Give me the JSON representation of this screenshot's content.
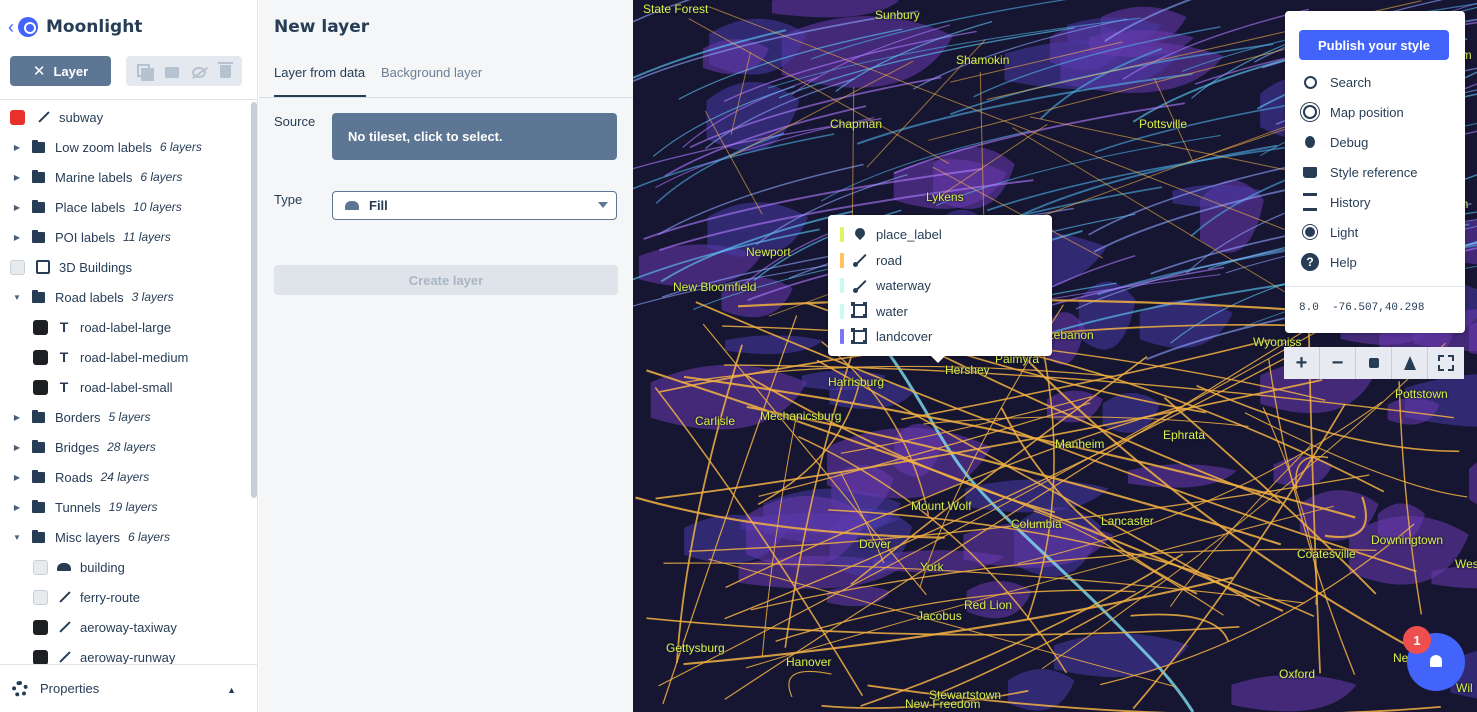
{
  "app": {
    "name": "Moonlight",
    "back_icon": "chevron-left-icon",
    "logo_icon": "mapbox-logo-icon"
  },
  "toolbar": {
    "layer_button": "Layer",
    "close_icon": "close-icon"
  },
  "layers": [
    {
      "kind": "layer",
      "name": "subway",
      "color": "#e8302c",
      "icon": "line"
    },
    {
      "kind": "group",
      "name": "Low zoom labels",
      "count": "6 layers",
      "expanded": false
    },
    {
      "kind": "group",
      "name": "Marine labels",
      "count": "6 layers",
      "expanded": false
    },
    {
      "kind": "group",
      "name": "Place labels",
      "count": "10 layers",
      "expanded": false
    },
    {
      "kind": "group",
      "name": "POI labels",
      "count": "11 layers",
      "expanded": false
    },
    {
      "kind": "layer",
      "name": "3D Buildings",
      "color": "#e8ebee",
      "icon": "cube"
    },
    {
      "kind": "group",
      "name": "Road labels",
      "count": "3 layers",
      "expanded": true
    },
    {
      "kind": "child",
      "name": "road-label-large",
      "color": "#1d1f22",
      "icon": "text"
    },
    {
      "kind": "child",
      "name": "road-label-medium",
      "color": "#1d1f22",
      "icon": "text"
    },
    {
      "kind": "child",
      "name": "road-label-small",
      "color": "#1d1f22",
      "icon": "text"
    },
    {
      "kind": "group",
      "name": "Borders",
      "count": "5 layers",
      "expanded": false
    },
    {
      "kind": "group",
      "name": "Bridges",
      "count": "28 layers",
      "expanded": false
    },
    {
      "kind": "group",
      "name": "Roads",
      "count": "24 layers",
      "expanded": false
    },
    {
      "kind": "group",
      "name": "Tunnels",
      "count": "19 layers",
      "expanded": false
    },
    {
      "kind": "group",
      "name": "Misc layers",
      "count": "6 layers",
      "expanded": true
    },
    {
      "kind": "child",
      "name": "building",
      "color": "#e8ebee",
      "icon": "fill"
    },
    {
      "kind": "child",
      "name": "ferry-route",
      "color": "#e8ebee",
      "icon": "line"
    },
    {
      "kind": "child",
      "name": "aeroway-taxiway",
      "color": "#1d1f22",
      "icon": "line"
    },
    {
      "kind": "child",
      "name": "aeroway-runway",
      "color": "#1d1f22",
      "icon": "line"
    }
  ],
  "properties": {
    "label": "Properties"
  },
  "new_layer": {
    "title": "New layer",
    "tabs": [
      "Layer from data",
      "Background layer"
    ],
    "source_label": "Source",
    "source_value": "No tileset, click to select.",
    "type_label": "Type",
    "type_value": "Fill",
    "create_button": "Create layer"
  },
  "map": {
    "places": [
      {
        "name": "State Forest"
      },
      {
        "name": "Sunbury"
      },
      {
        "name": "Shamokin"
      },
      {
        "name": "Chapman"
      },
      {
        "name": "Pottsville"
      },
      {
        "name": "Lykens"
      },
      {
        "name": "Newport"
      },
      {
        "name": "New Bloomfield"
      },
      {
        "name": "Lebanon"
      },
      {
        "name": "Harrisburg"
      },
      {
        "name": "Hershey"
      },
      {
        "name": "Mechanicsburg"
      },
      {
        "name": "Carlisle"
      },
      {
        "name": "Manheim"
      },
      {
        "name": "Ephrata"
      },
      {
        "name": "Mount Wolf"
      },
      {
        "name": "Columbia"
      },
      {
        "name": "Lancaster"
      },
      {
        "name": "Dover"
      },
      {
        "name": "York"
      },
      {
        "name": "Red Lion"
      },
      {
        "name": "Jacobus"
      },
      {
        "name": "Gettysburg"
      },
      {
        "name": "Hanover"
      },
      {
        "name": "Stewartstown"
      },
      {
        "name": "New Freedom"
      },
      {
        "name": "Oxford"
      },
      {
        "name": "Coatesville"
      },
      {
        "name": "Downingtown"
      },
      {
        "name": "West G"
      },
      {
        "name": "Pottstown"
      },
      {
        "name": "New Gar"
      },
      {
        "name": "Wyomiss"
      },
      {
        "name": "Ham"
      },
      {
        "name": "Tam"
      },
      {
        "name": "Wil"
      },
      {
        "name": "Palmyra"
      }
    ],
    "popup": [
      {
        "name": "place_label",
        "color": "#d9f75f",
        "icon": "pin"
      },
      {
        "name": "road",
        "color": "#ffc25c",
        "icon": "road"
      },
      {
        "name": "waterway",
        "color": "#c6faf3",
        "icon": "road"
      },
      {
        "name": "water",
        "color": "#c6faf3",
        "icon": "poly"
      },
      {
        "name": "landcover",
        "color": "#7b74f6",
        "icon": "poly"
      }
    ],
    "menu": {
      "publish": "Publish your style",
      "items": [
        {
          "label": "Search",
          "icon": "search-icon"
        },
        {
          "label": "Map position",
          "icon": "target-icon"
        },
        {
          "label": "Debug",
          "icon": "bug-icon"
        },
        {
          "label": "Style reference",
          "icon": "book-icon"
        },
        {
          "label": "History",
          "icon": "history-icon"
        },
        {
          "label": "Light",
          "icon": "sun-icon"
        },
        {
          "label": "Help",
          "icon": "help-icon"
        }
      ],
      "zoom": "8.0",
      "coords": "-76.507,40.298"
    },
    "controls": {
      "zoom_in": "+",
      "zoom_out": "−"
    },
    "notifications": {
      "count": "1"
    }
  }
}
